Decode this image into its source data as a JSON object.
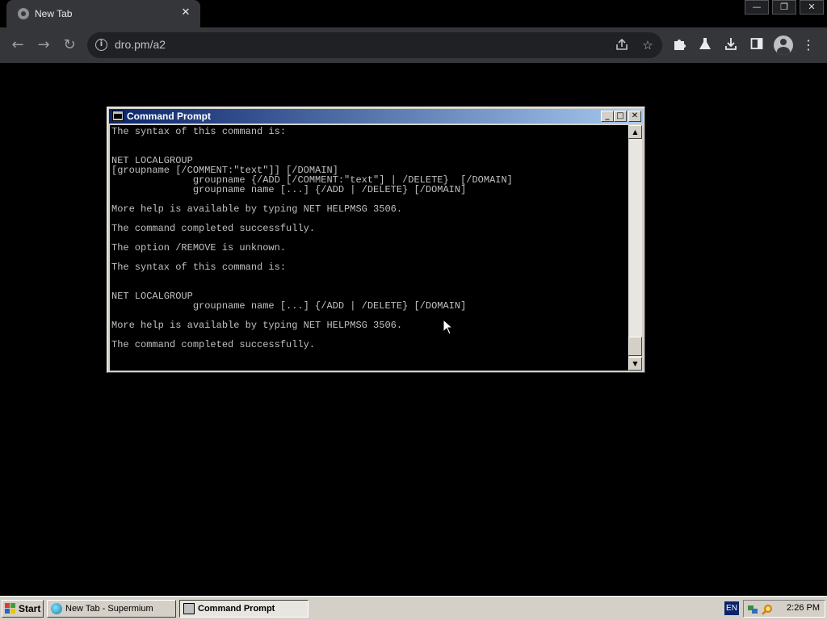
{
  "browser": {
    "tab_title": "New Tab",
    "tab_close": "✕",
    "url": "dro.pm/a2",
    "window_controls": [
      "—",
      "❐",
      "✕"
    ],
    "nav": {
      "back": "←",
      "forward": "→",
      "reload": "↻"
    },
    "icons": [
      "share-icon",
      "star-icon",
      "extensions-icon",
      "labs-icon",
      "download-icon",
      "sidepanel-icon",
      "profile-icon",
      "menu-icon"
    ]
  },
  "cmd": {
    "title": "Command Prompt",
    "lines": [
      "The syntax of this command is:",
      "",
      "",
      "NET LOCALGROUP",
      "[groupname [/COMMENT:\"text\"]] [/DOMAIN]",
      "              groupname {/ADD [/COMMENT:\"text\"] | /DELETE}  [/DOMAIN]",
      "              groupname name [...] {/ADD | /DELETE} [/DOMAIN]",
      "",
      "More help is available by typing NET HELPMSG 3506.",
      "",
      "The command completed successfully.",
      "",
      "The option /REMOVE is unknown.",
      "",
      "The syntax of this command is:",
      "",
      "",
      "NET LOCALGROUP",
      "              groupname name [...] {/ADD | /DELETE} [/DOMAIN]",
      "",
      "More help is available by typing NET HELPMSG 3506.",
      "",
      "The command completed successfully.",
      ""
    ],
    "caption_buttons": {
      "minimize": "_",
      "maximize": "□",
      "close": "✕"
    },
    "scroll_up": "▲",
    "scroll_down": "▼"
  },
  "taskbar": {
    "start_label": "Start",
    "tasks": [
      {
        "label": "New Tab - Supermium",
        "active": false
      },
      {
        "label": "Command Prompt",
        "active": true
      }
    ],
    "language": "EN",
    "time": "2:26 PM"
  },
  "colors": {
    "console_text": "#c0c0c0",
    "titlebar_start": "#0a246a",
    "titlebar_end": "#a6caf0"
  }
}
